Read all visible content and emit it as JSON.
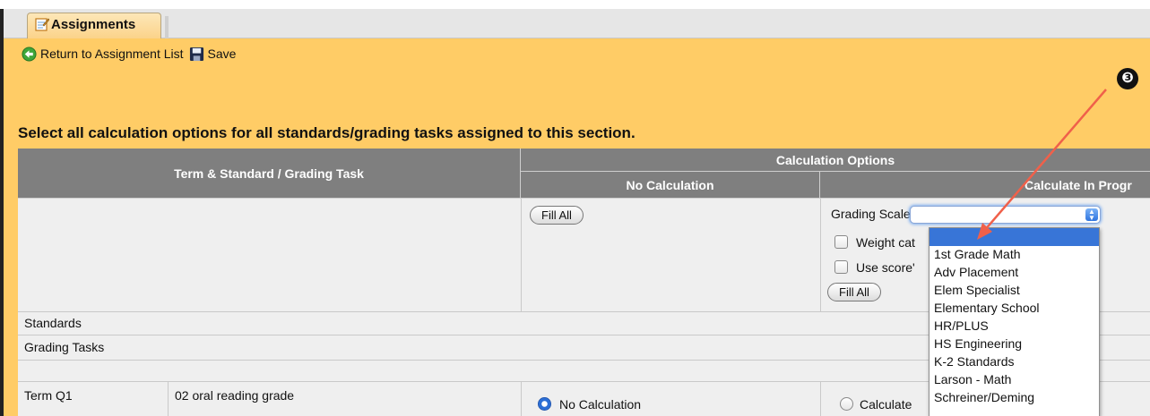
{
  "tab": {
    "label": "Assignments",
    "icon": "notepad-icon"
  },
  "toolbar": {
    "return_label": "Return to Assignment List",
    "return_icon": "green-back-arrow-icon",
    "save_label": "Save",
    "save_icon": "floppy-disk-icon"
  },
  "instruction": "Select all calculation options for all standards/grading tasks assigned to this section.",
  "annotation": {
    "step_number": "❸",
    "arrow_color": "#f0604a"
  },
  "table": {
    "header": {
      "term_standard": "Term & Standard / Grading Task",
      "calculation_options": "Calculation Options",
      "no_calculation": "No Calculation",
      "calculate_in_progress": "Calculate In Progr"
    },
    "fill_all_label": "Fill All",
    "grading_scale_label": "Grading Scale:",
    "grading_scale_value": "",
    "weight_categories_label": "Weight cat",
    "use_scores_label": "Use score'",
    "sections": {
      "standards": "Standards",
      "grading_tasks": "Grading Tasks"
    },
    "rows": [
      {
        "term": "Term Q1",
        "task": "02 oral reading grade",
        "no_calc_option": "No Calculation",
        "no_calc_selected": true,
        "calc_option": "Calculate",
        "calc_selected": false
      }
    ]
  },
  "dropdown": {
    "options": [
      "",
      "1st Grade Math",
      "Adv Placement",
      "Elem Specialist",
      "Elementary School",
      "HR/PLUS",
      "HS Engineering",
      "K-2 Standards",
      "Larson - Math",
      "Schreiner/Deming"
    ],
    "highlighted_index": 0
  },
  "colors": {
    "background": "#ffcc66",
    "header": "#7f7f7f",
    "row": "#efefef",
    "selection": "#3875d7"
  }
}
